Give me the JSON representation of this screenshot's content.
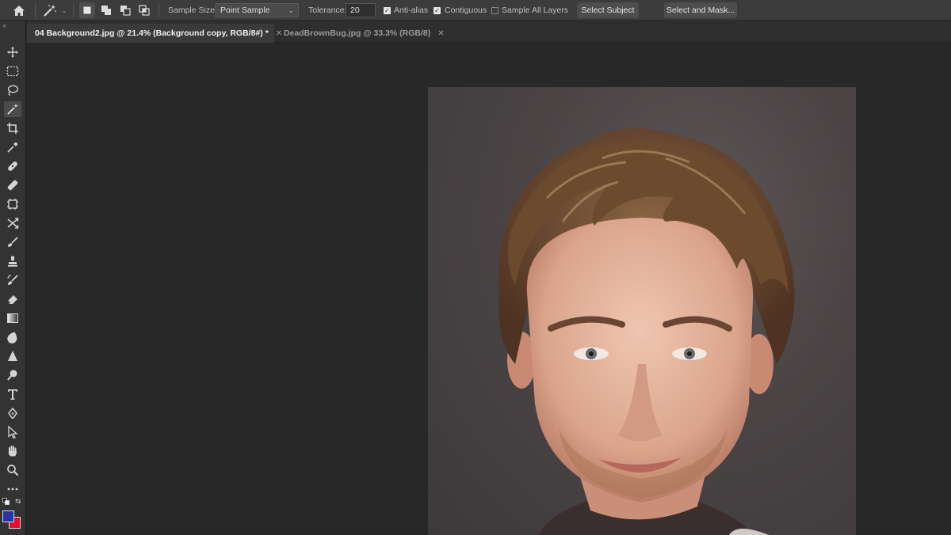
{
  "options_bar": {
    "tool_icon": "magic-wand-icon",
    "selection_modes": [
      "new-selection-icon",
      "add-to-selection-icon",
      "subtract-from-selection-icon",
      "intersect-selection-icon"
    ],
    "sample_size_label": "Sample Size:",
    "sample_size_value": "Point Sample",
    "tolerance_label": "Tolerance:",
    "tolerance_value": "20",
    "anti_alias_label": "Anti-alias",
    "anti_alias_checked": true,
    "contiguous_label": "Contiguous",
    "contiguous_checked": true,
    "sample_all_layers_label": "Sample All Layers",
    "sample_all_layers_checked": false,
    "select_subject_label": "Select Subject",
    "select_and_mask_label": "Select and Mask..."
  },
  "tabs": [
    {
      "label": "04 Background2.jpg @ 21.4% (Background copy, RGB/8#) *",
      "active": true
    },
    {
      "label": "DeadBrownBug.jpg @ 33.3% (RGB/8)",
      "active": false
    }
  ],
  "toolbar": {
    "tools": [
      "move-tool-icon",
      "marquee-tool-icon",
      "lasso-tool-icon",
      "magic-wand-tool-icon",
      "crop-tool-icon",
      "eyedropper-tool-icon",
      "healing-brush-icon",
      "patch-tool-icon",
      "frame-tool-icon",
      "content-aware-move-icon",
      "brush-tool-icon",
      "clone-stamp-icon",
      "history-brush-icon",
      "eraser-tool-icon",
      "gradient-tool-icon",
      "blur-tool-icon",
      "sharpen-tool-icon",
      "dodge-tool-icon",
      "type-tool-icon",
      "pen-tool-icon",
      "path-selection-icon",
      "hand-tool-icon",
      "zoom-tool-icon",
      "more-tools-icon"
    ],
    "selected_tool": "magic-wand-tool-icon",
    "foreground_color": "#2634a8",
    "background_color": "#e0102e"
  },
  "colors": {
    "options_bar_bg": "#3c3c3c",
    "workspace_bg": "#282828",
    "photo_backdrop": "#4a4445",
    "hair": "#6b4a2e",
    "skin": "#e0b49e"
  }
}
